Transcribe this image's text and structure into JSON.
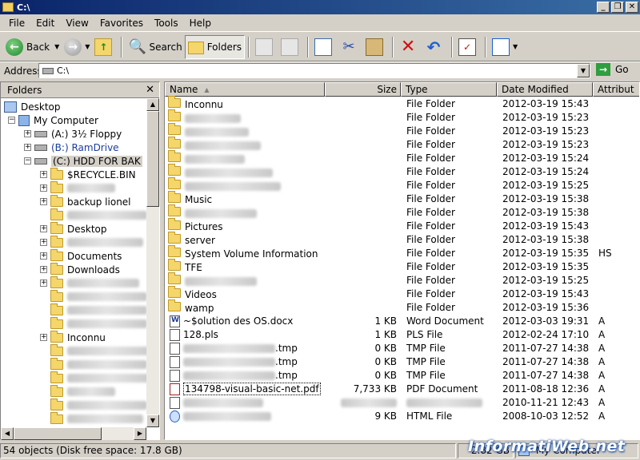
{
  "window": {
    "title": "C:\\"
  },
  "menu": [
    "File",
    "Edit",
    "View",
    "Favorites",
    "Tools",
    "Help"
  ],
  "toolbar": {
    "back": "Back",
    "search": "Search",
    "folders": "Folders"
  },
  "address": {
    "label": "Address",
    "value": "C:\\",
    "go": "Go"
  },
  "folders_pane": {
    "title": "Folders",
    "nodes": [
      {
        "label": "Desktop",
        "level": 0
      },
      {
        "label": "My Computer",
        "level": 1
      },
      {
        "label": "(A:) 3½ Floppy",
        "level": 2
      },
      {
        "label": "(B:) RamDrive",
        "level": 2
      },
      {
        "label": "(C:) HDD FOR BAK",
        "level": 2
      },
      {
        "label": "$RECYCLE.BIN",
        "level": 3
      },
      {
        "label": "",
        "level": 3
      },
      {
        "label": "backup lionel",
        "level": 3
      },
      {
        "label": "",
        "level": 3
      },
      {
        "label": "Desktop",
        "level": 3
      },
      {
        "label": "",
        "level": 3
      },
      {
        "label": "Documents",
        "level": 3
      },
      {
        "label": "Downloads",
        "level": 3
      },
      {
        "label": "",
        "level": 3
      },
      {
        "label": "",
        "level": 3
      },
      {
        "label": "",
        "level": 3
      },
      {
        "label": "",
        "level": 3
      },
      {
        "label": "Inconnu",
        "level": 3
      },
      {
        "label": "",
        "level": 3
      },
      {
        "label": "",
        "level": 3
      },
      {
        "label": "",
        "level": 3
      },
      {
        "label": "",
        "level": 3
      },
      {
        "label": "",
        "level": 3
      },
      {
        "label": "",
        "level": 3
      }
    ]
  },
  "columns": {
    "name": "Name",
    "size": "Size",
    "type": "Type",
    "date": "Date Modified",
    "attr": "Attribut"
  },
  "files": [
    {
      "name": "Inconnu",
      "size": "",
      "type": "File Folder",
      "date": "2012-03-19 15:43",
      "attr": "",
      "icon": "folder"
    },
    {
      "name": "",
      "size": "",
      "type": "File Folder",
      "date": "2012-03-19 15:23",
      "attr": "",
      "icon": "folder"
    },
    {
      "name": "",
      "size": "",
      "type": "File Folder",
      "date": "2012-03-19 15:23",
      "attr": "",
      "icon": "folder"
    },
    {
      "name": "",
      "size": "",
      "type": "File Folder",
      "date": "2012-03-19 15:23",
      "attr": "",
      "icon": "folder"
    },
    {
      "name": "",
      "size": "",
      "type": "File Folder",
      "date": "2012-03-19 15:24",
      "attr": "",
      "icon": "folder"
    },
    {
      "name": "",
      "size": "",
      "type": "File Folder",
      "date": "2012-03-19 15:24",
      "attr": "",
      "icon": "folder"
    },
    {
      "name": "",
      "size": "",
      "type": "File Folder",
      "date": "2012-03-19 15:25",
      "attr": "",
      "icon": "folder"
    },
    {
      "name": "Music",
      "size": "",
      "type": "File Folder",
      "date": "2012-03-19 15:38",
      "attr": "",
      "icon": "folder"
    },
    {
      "name": "",
      "size": "",
      "type": "File Folder",
      "date": "2012-03-19 15:38",
      "attr": "",
      "icon": "folder"
    },
    {
      "name": "Pictures",
      "size": "",
      "type": "File Folder",
      "date": "2012-03-19 15:43",
      "attr": "",
      "icon": "folder"
    },
    {
      "name": "server",
      "size": "",
      "type": "File Folder",
      "date": "2012-03-19 15:38",
      "attr": "",
      "icon": "folder"
    },
    {
      "name": "System Volume Information",
      "size": "",
      "type": "File Folder",
      "date": "2012-03-19 15:35",
      "attr": "HS",
      "icon": "folder"
    },
    {
      "name": "TFE",
      "size": "",
      "type": "File Folder",
      "date": "2012-03-19 15:35",
      "attr": "",
      "icon": "folder"
    },
    {
      "name": "",
      "size": "",
      "type": "File Folder",
      "date": "2012-03-19 15:25",
      "attr": "",
      "icon": "folder"
    },
    {
      "name": "Videos",
      "size": "",
      "type": "File Folder",
      "date": "2012-03-19 15:43",
      "attr": "",
      "icon": "folder"
    },
    {
      "name": "wamp",
      "size": "",
      "type": "File Folder",
      "date": "2012-03-19 15:36",
      "attr": "",
      "icon": "folder"
    },
    {
      "name": "~$olution des OS.docx",
      "size": "1 KB",
      "type": "Word Document",
      "date": "2012-03-03 19:31",
      "attr": "A",
      "icon": "word"
    },
    {
      "name": "128.pls",
      "size": "1 KB",
      "type": "PLS File",
      "date": "2012-02-24 17:10",
      "attr": "A",
      "icon": "doc"
    },
    {
      "name": ".tmp",
      "size": "0 KB",
      "type": "TMP File",
      "date": "2011-07-27 14:38",
      "attr": "A",
      "icon": "doc"
    },
    {
      "name": ".tmp",
      "size": "0 KB",
      "type": "TMP File",
      "date": "2011-07-27 14:38",
      "attr": "A",
      "icon": "doc"
    },
    {
      "name": ".tmp",
      "size": "0 KB",
      "type": "TMP File",
      "date": "2011-07-27 14:38",
      "attr": "A",
      "icon": "doc"
    },
    {
      "name": "134798-visual-basic-net.pdf",
      "size": "7,733 KB",
      "type": "PDF Document",
      "date": "2011-08-18 12:36",
      "attr": "A",
      "icon": "pdf"
    },
    {
      "name": "",
      "size": "",
      "type": "",
      "date": "2010-11-21 12:43",
      "attr": "A",
      "icon": "doc"
    },
    {
      "name": "",
      "size": "9 KB",
      "type": "HTML File",
      "date": "2008-10-03 12:52",
      "attr": "A",
      "icon": "ie"
    }
  ],
  "status": {
    "objects": "54 objects (Disk free space: 17.8 GB)",
    "size": "2.82 GB",
    "location": "My Computer"
  },
  "watermark": "InformatiWeb.net"
}
